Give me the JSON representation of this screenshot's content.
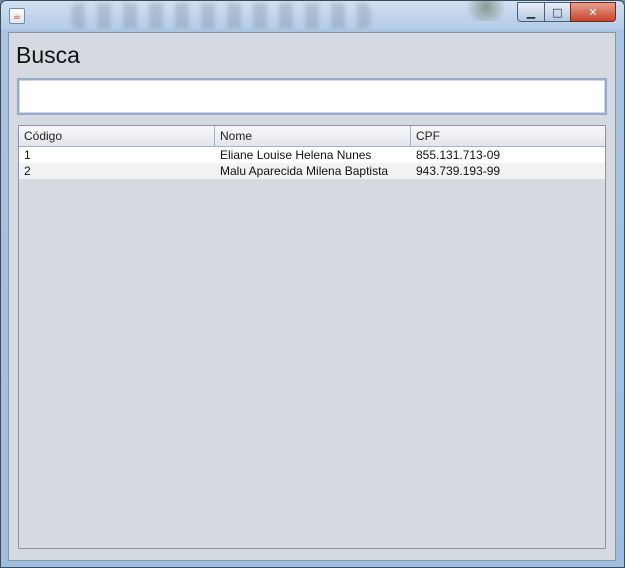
{
  "window": {
    "app_icon": "java-icon",
    "controls": {
      "minimize": "▁",
      "maximize": "□",
      "close": "✕"
    }
  },
  "form": {
    "heading": "Busca",
    "search_value": "",
    "search_placeholder": ""
  },
  "table": {
    "columns": [
      "Código",
      "Nome",
      "CPF"
    ],
    "rows": [
      [
        "1",
        "Eliane Louise Helena Nunes",
        "855.131.713-09"
      ],
      [
        "2",
        "Malu Aparecida Milena Baptista",
        "943.739.193-99"
      ]
    ]
  }
}
